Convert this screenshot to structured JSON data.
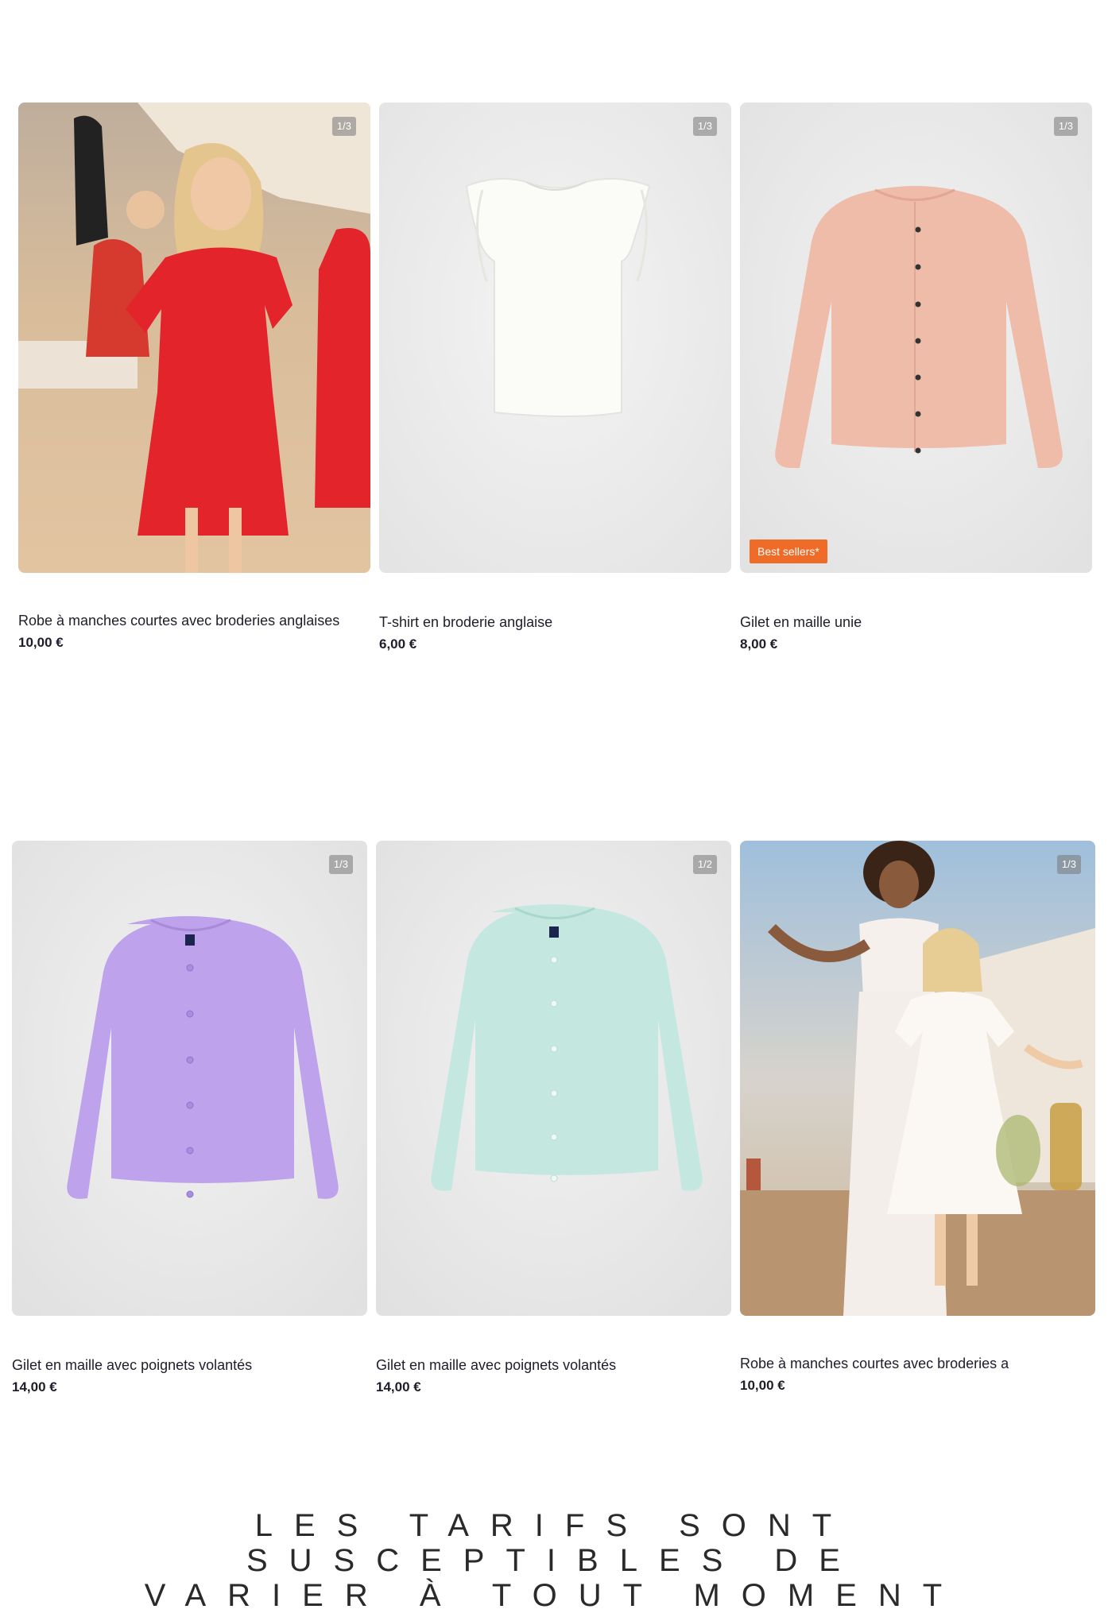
{
  "products": [
    {
      "title": "Robe à manches courtes avec broderies anglaises",
      "price": "10,00 €",
      "counter": "1/3",
      "image": "girl-red-dress-beach-photo"
    },
    {
      "title": "T-shirt en broderie anglaise",
      "price": "6,00 €",
      "counter": "1/3",
      "image": "white-ruffle-tshirt-photo"
    },
    {
      "title": "Gilet en maille unie",
      "price": "8,00 €",
      "counter": "1/3",
      "badge": "Best sellers*",
      "image": "pink-cardigan-photo"
    },
    {
      "title": "Gilet en maille avec poignets volantés",
      "price": "14,00 €",
      "counter": "1/3",
      "image": "lilac-cardigan-photo"
    },
    {
      "title": "Gilet en maille avec poignets volantés",
      "price": "14,00 €",
      "counter": "1/2",
      "image": "mint-cardigan-photo"
    },
    {
      "title": "Robe à manches courtes avec broderies a",
      "price": "10,00 €",
      "counter": "1/3",
      "image": "woman-girl-white-dress-photo"
    }
  ],
  "disclaimer_line1": "LES TARIFS SONT SUSCEPTIBLES DE",
  "disclaimer_line2": "VARIER À TOUT MOMENT",
  "colors": {
    "badge": "#f06b28",
    "text": "#1d1d2b"
  }
}
